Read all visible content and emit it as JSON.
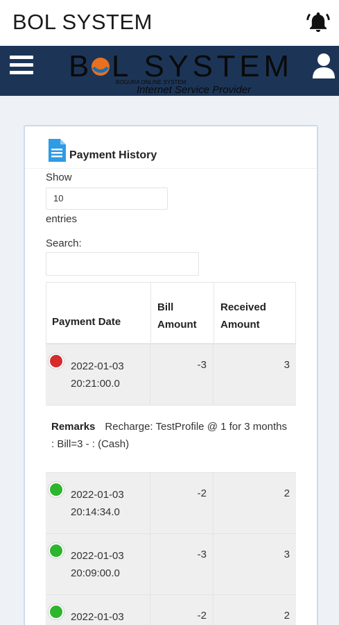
{
  "app": {
    "title": "BOL SYSTEM",
    "icons": {
      "notifications": "bell-icon",
      "menu": "hamburger-icon",
      "profile": "user-icon",
      "document": "document-icon"
    }
  },
  "logo": {
    "main": "BOL SYSTEM",
    "tagline": "BOGURA ONLINE SYSTEM",
    "subtitle": "Internet Service Provider"
  },
  "card": {
    "title": "Payment History"
  },
  "controls": {
    "show_label": "Show",
    "show_value": "10",
    "entries_label": "entries",
    "search_label": "Search:",
    "search_value": ""
  },
  "table": {
    "headers": {
      "date": "Payment Date",
      "bill": "Bill Amount",
      "received": "Received Amount"
    },
    "remarks_label": "Remarks",
    "rows": [
      {
        "status": "red",
        "date": "2022-01-03 20:21:00.0",
        "bill": "-3",
        "received": "3",
        "remarks": "Recharge: TestProfile @ 1 for 3 months : Bill=3 - : (Cash)"
      },
      {
        "status": "green",
        "date": "2022-01-03 20:14:34.0",
        "bill": "-2",
        "received": "2"
      },
      {
        "status": "green",
        "date": "2022-01-03 20:09:00.0",
        "bill": "-3",
        "received": "3"
      },
      {
        "status": "green",
        "date": "2022-01-03",
        "bill": "-2",
        "received": "2"
      }
    ]
  },
  "colors": {
    "navbar": "#1c3557",
    "status_red": "#d62b2b",
    "status_green": "#2db52d",
    "logo_orange": "#e8701f",
    "logo_blue": "#1a6fb5"
  }
}
